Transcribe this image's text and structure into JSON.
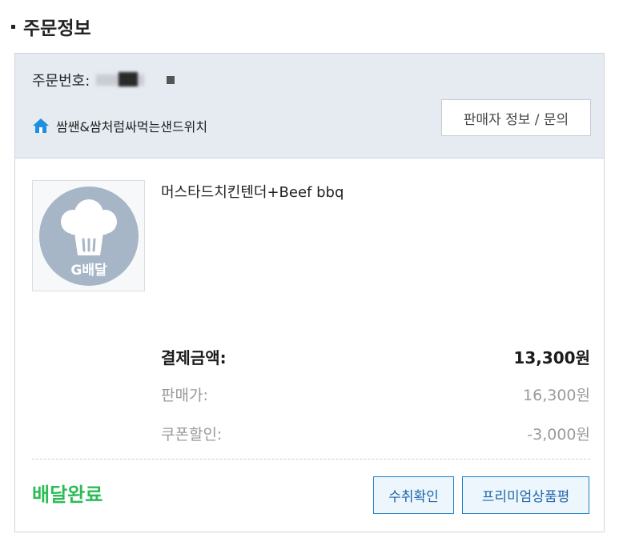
{
  "section": {
    "title": "주문정보"
  },
  "order": {
    "number_label": "주문번호:",
    "store_name": "쌈쌘&쌈처럼싸먹는샌드위치",
    "seller_button": "판매자 정보 / 문의"
  },
  "product": {
    "name": "머스타드치킨텐더+Beef bbq",
    "thumbnail_label": "G배달"
  },
  "prices": {
    "total_label": "결제금액:",
    "total_value": "13,300원",
    "sale_label": "판매가:",
    "sale_value": "16,300원",
    "coupon_label": "쿠폰할인:",
    "coupon_value": "-3,000원"
  },
  "status": {
    "text": "배달완료"
  },
  "actions": {
    "confirm_label": "수취확인",
    "review_label": "프리미엄상품평"
  },
  "colors": {
    "header_bg": "#e6ebf2",
    "status_green": "#2dbb58",
    "button_blue": "#1f7fc9",
    "home_icon_blue": "#1f8fe0",
    "thumb_circle": "#a7b6c6"
  },
  "icons": {
    "store": "home-icon",
    "thumbnail": "chef-hat-icon"
  }
}
